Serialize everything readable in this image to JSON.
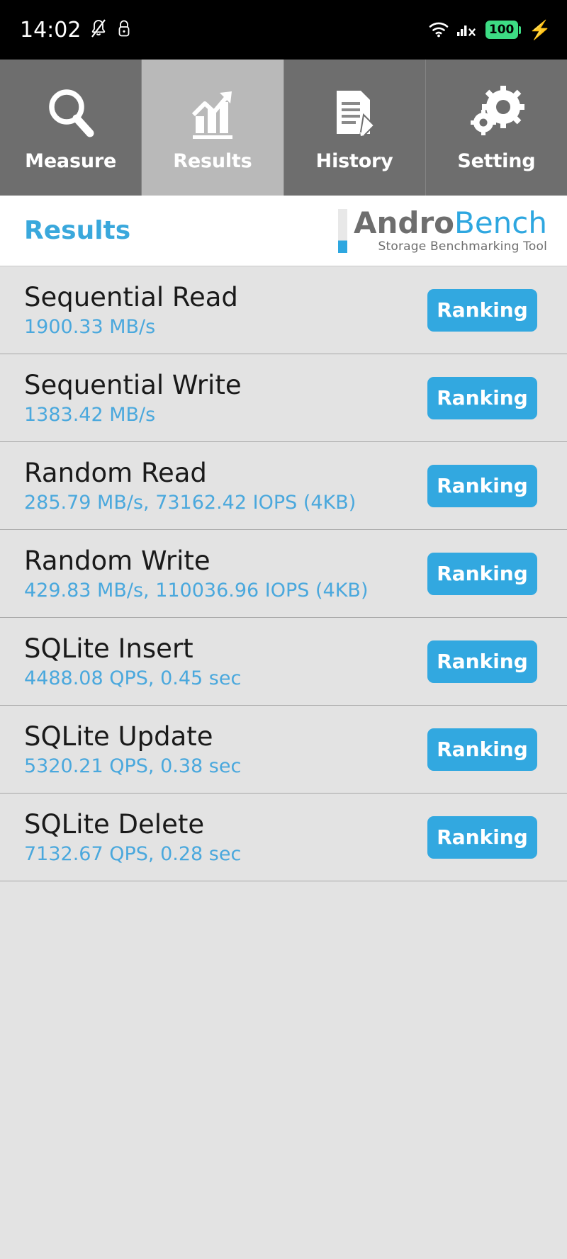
{
  "status_bar": {
    "time": "14:02",
    "icons_left": [
      "bell-off-icon",
      "lock-icon"
    ],
    "icons_right": [
      "wifi-icon",
      "cellular-signal-off-icon",
      "battery-icon"
    ],
    "battery_level": "100",
    "charging_glyph": "⚡"
  },
  "tabs": [
    {
      "label": "Measure",
      "icon": "magnifier-icon",
      "active": false
    },
    {
      "label": "Results",
      "icon": "bar-chart-arrow-icon",
      "active": true
    },
    {
      "label": "History",
      "icon": "document-pencil-icon",
      "active": false
    },
    {
      "label": "Setting",
      "icon": "gears-icon",
      "active": false
    }
  ],
  "header": {
    "title": "Results",
    "logo_primary": "Andro",
    "logo_secondary": "Bench",
    "logo_subtitle": "Storage Benchmarking Tool"
  },
  "colors": {
    "accent_blue": "#32a8e0",
    "title_blue": "#3aa8dc",
    "value_blue": "#4aa8dd",
    "tab_inactive": "#6e6e6e",
    "tab_active": "#b9b9b9",
    "list_background": "#e3e3e3",
    "battery_green": "#3ddc84"
  },
  "results": [
    {
      "name": "Sequential Read",
      "value": "1900.33 MB/s",
      "button": "Ranking"
    },
    {
      "name": "Sequential Write",
      "value": "1383.42 MB/s",
      "button": "Ranking"
    },
    {
      "name": "Random Read",
      "value": "285.79 MB/s, 73162.42 IOPS (4KB)",
      "button": "Ranking"
    },
    {
      "name": "Random Write",
      "value": "429.83 MB/s, 110036.96 IOPS (4KB)",
      "button": "Ranking"
    },
    {
      "name": "SQLite Insert",
      "value": "4488.08 QPS, 0.45 sec",
      "button": "Ranking"
    },
    {
      "name": "SQLite Update",
      "value": "5320.21 QPS, 0.38 sec",
      "button": "Ranking"
    },
    {
      "name": "SQLite Delete",
      "value": "7132.67 QPS, 0.28 sec",
      "button": "Ranking"
    }
  ]
}
